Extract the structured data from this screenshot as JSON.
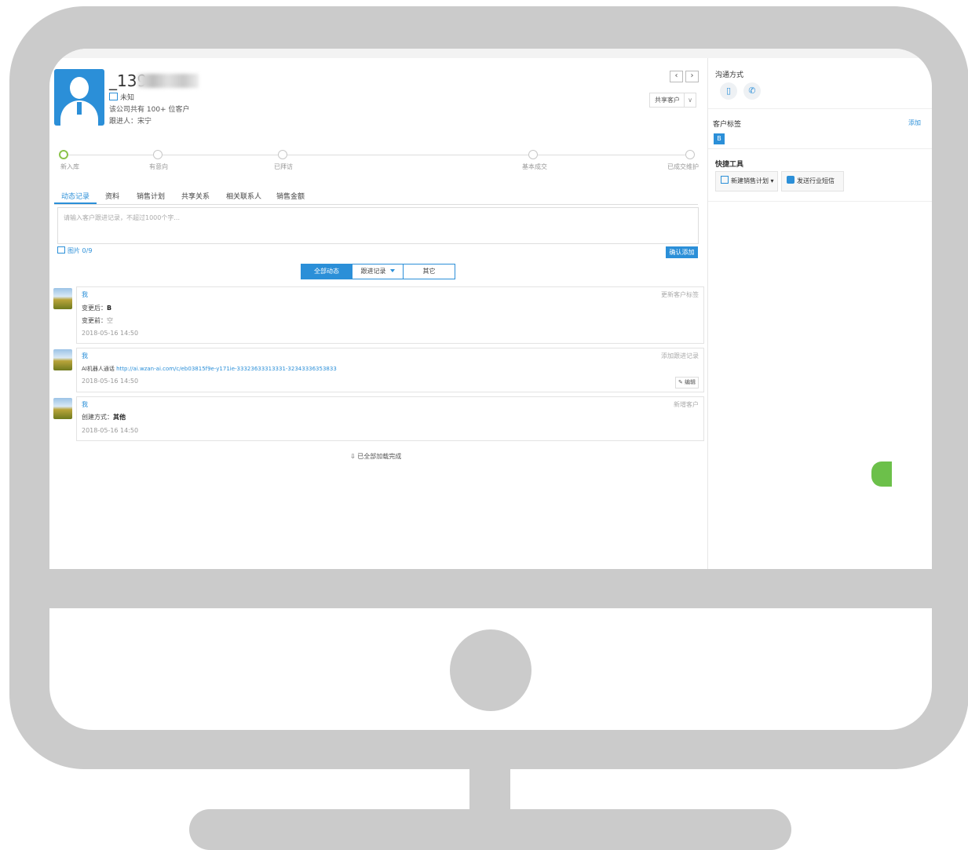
{
  "customer": {
    "name": "_139",
    "company": "未知",
    "company_count": "该公司共有 100+ 位客户",
    "follower": "跟进人：宋宁"
  },
  "header": {
    "prev_icon": "‹",
    "next_icon": "›",
    "share_label": "共享客户",
    "share_arrow": "∨"
  },
  "stages": [
    "新入库",
    "有意向",
    "已拜访",
    "基本成交",
    "已成交维护"
  ],
  "tabs": [
    "动态记录",
    "资料",
    "销售计划",
    "共享关系",
    "相关联系人",
    "销售金额"
  ],
  "composer": {
    "placeholder": "请输入客户跟进记录，不超过1000个字...",
    "image_count": "图片 0/9",
    "confirm": "确认添加"
  },
  "filters": {
    "all": "全部动态",
    "follow": "跟进记录",
    "other": "其它"
  },
  "feed": [
    {
      "user": "我",
      "type": "更新客户标签",
      "line1_label": "变更后：",
      "line1_value": "B",
      "line2_label": "变更前：",
      "line2_value": "空",
      "time": "2018-05-16 14:50"
    },
    {
      "user": "我",
      "type": "添加跟进记录",
      "label": "AI机器人通话",
      "link": "http://ai.wzan-ai.com/c/eb03815f9e-y171ie-33323633313331-32343336353833",
      "time": "2018-05-16 14:50",
      "edit": "编辑"
    },
    {
      "user": "我",
      "type": "新增客户",
      "line1_label": "创建方式：",
      "line1_value": "其他",
      "time": "2018-05-16 14:50"
    }
  ],
  "load_done": "已全部加载完成",
  "sidebar": {
    "contact_title": "沟通方式",
    "tags_title": "客户标签",
    "add_tag": "添加",
    "tag": "B",
    "tools_title": "快捷工具",
    "tool_new_plan": "新建销售计划",
    "tool_send_sms": "发送行业短信"
  },
  "colors": {
    "accent": "#2b8fd8",
    "active_stage": "#8bc34a",
    "frame": "#cbcbcb"
  },
  "icons": {
    "phone": "phone-icon",
    "mobile": "mobile-icon",
    "company": "building-icon"
  }
}
